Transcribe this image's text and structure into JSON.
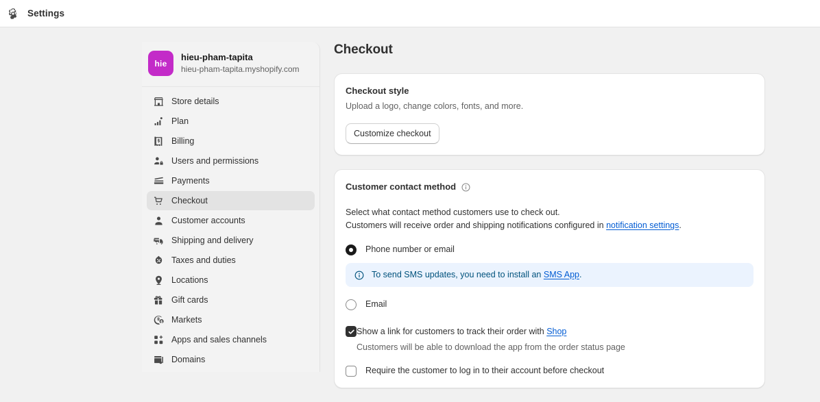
{
  "topbar": {
    "title": "Settings",
    "gear_icon": "gear-icon"
  },
  "sidebar": {
    "store": {
      "avatar_initials": "hie",
      "avatar_color": "#c32bc8",
      "name": "hieu-pham-tapita",
      "domain": "hieu-pham-tapita.myshopify.com"
    },
    "items": [
      {
        "label": "Store details",
        "icon": "store-icon",
        "selected": false
      },
      {
        "label": "Plan",
        "icon": "plan-chart-icon",
        "selected": false
      },
      {
        "label": "Billing",
        "icon": "billing-receipt-icon",
        "selected": false
      },
      {
        "label": "Users and permissions",
        "icon": "users-icon",
        "selected": false
      },
      {
        "label": "Payments",
        "icon": "payments-card-icon",
        "selected": false
      },
      {
        "label": "Checkout",
        "icon": "cart-icon",
        "selected": true
      },
      {
        "label": "Customer accounts",
        "icon": "person-icon",
        "selected": false
      },
      {
        "label": "Shipping and delivery",
        "icon": "truck-icon",
        "selected": false
      },
      {
        "label": "Taxes and duties",
        "icon": "taxes-icon",
        "selected": false
      },
      {
        "label": "Locations",
        "icon": "location-pin-icon",
        "selected": false
      },
      {
        "label": "Gift cards",
        "icon": "gift-card-icon",
        "selected": false
      },
      {
        "label": "Markets",
        "icon": "globe-currency-icon",
        "selected": false
      },
      {
        "label": "Apps and sales channels",
        "icon": "apps-grid-icon",
        "selected": false
      },
      {
        "label": "Domains",
        "icon": "domains-window-icon",
        "selected": false
      }
    ]
  },
  "main": {
    "page_title": "Checkout",
    "checkout_style": {
      "title": "Checkout style",
      "subtitle": "Upload a logo, change colors, fonts, and more.",
      "button_label": "Customize checkout"
    },
    "contact_method": {
      "title": "Customer contact method",
      "info_icon": "info-circle-icon",
      "description_line1": "Select what contact method customers use to check out.",
      "description_line2_prefix": "Customers will receive order and shipping notifications configured in ",
      "description_line2_link": "notification settings",
      "description_line2_suffix": ".",
      "options": [
        {
          "label": "Phone number or email",
          "selected": true
        },
        {
          "label": "Email",
          "selected": false
        }
      ],
      "banner": {
        "icon": "info-circle-icon",
        "text_prefix": "To send SMS updates, you need to install an ",
        "link": "SMS App",
        "text_suffix": ".",
        "background": "#ebf3fe",
        "text_color": "#00527c"
      },
      "checkboxes": [
        {
          "label_prefix": "Show a link for customers to track their order with ",
          "label_link": "Shop",
          "label_suffix": "",
          "help": "Customers will be able to download the app from the order status page",
          "checked": true
        },
        {
          "label_prefix": "Require the customer to log in to their account before checkout",
          "label_link": "",
          "label_suffix": "",
          "help": "",
          "checked": false
        }
      ]
    }
  }
}
